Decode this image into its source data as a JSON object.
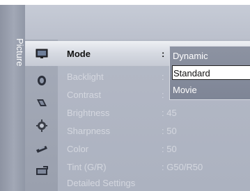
{
  "tab": {
    "label": "Picture"
  },
  "icons": [
    {
      "name": "picture-icon"
    },
    {
      "name": "sound-icon"
    },
    {
      "name": "channel-icon"
    },
    {
      "name": "setup-icon"
    },
    {
      "name": "input-icon"
    },
    {
      "name": "application-icon"
    }
  ],
  "menu": {
    "items": [
      {
        "label": "Mode",
        "value": ":",
        "selected": true
      },
      {
        "label": "Backlight",
        "value": ":"
      },
      {
        "label": "Contrast",
        "value": ":"
      },
      {
        "label": "Brightness",
        "value": ": 45"
      },
      {
        "label": "Sharpness",
        "value": ": 50"
      },
      {
        "label": "Color",
        "value": ": 50"
      },
      {
        "label": "Tint (G/R)",
        "value": ": G50/R50"
      },
      {
        "label": "Detailed Settings",
        "value": ""
      }
    ]
  },
  "dropdown": {
    "options": [
      {
        "label": "Dynamic"
      },
      {
        "label": "Standard",
        "highlighted": true
      },
      {
        "label": "Movie"
      }
    ]
  }
}
